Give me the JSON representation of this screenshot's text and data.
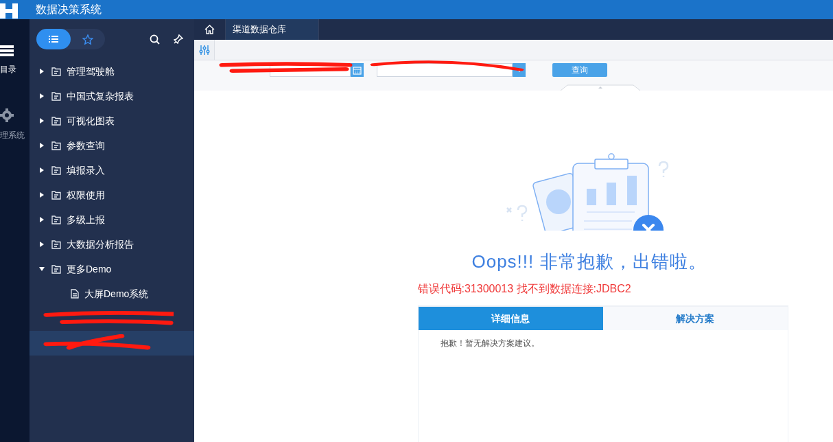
{
  "header": {
    "title": "数据决策系统"
  },
  "nav": [
    {
      "kind": "list",
      "label": "目录"
    },
    {
      "kind": "gear",
      "label": "理系统"
    }
  ],
  "sidebar": {
    "modes": [
      {
        "kind": "list",
        "selected": true
      },
      {
        "kind": "star",
        "selected": false
      }
    ],
    "items": [
      {
        "label": "管理驾驶舱",
        "expanded": false
      },
      {
        "label": "中国式复杂报表",
        "expanded": false
      },
      {
        "label": "可视化图表",
        "expanded": false
      },
      {
        "label": "参数查询",
        "expanded": false
      },
      {
        "label": "填报录入",
        "expanded": false
      },
      {
        "label": "权限使用",
        "expanded": false
      },
      {
        "label": "多级上报",
        "expanded": false
      },
      {
        "label": "大数据分析报告",
        "expanded": false
      },
      {
        "label": "更多Demo",
        "expanded": true,
        "children": [
          {
            "label": "大屏Demo系统"
          }
        ]
      }
    ],
    "redacted_rows": [
      {
        "selected": false
      },
      {
        "selected": true
      }
    ]
  },
  "tabs": [
    {
      "label": "渠道数据仓库",
      "selected": true
    }
  ],
  "form": {
    "button": "查询"
  },
  "error": {
    "title": "Oops!!! 非常抱歉，出错啦。",
    "message": "错误代码:31300013 找不到数据连接:JDBC2",
    "tabs": [
      {
        "label": "详细信息",
        "selected": true
      },
      {
        "label": "解决方案",
        "selected": false
      }
    ],
    "body": "抱歉！暂无解决方案建议。"
  }
}
